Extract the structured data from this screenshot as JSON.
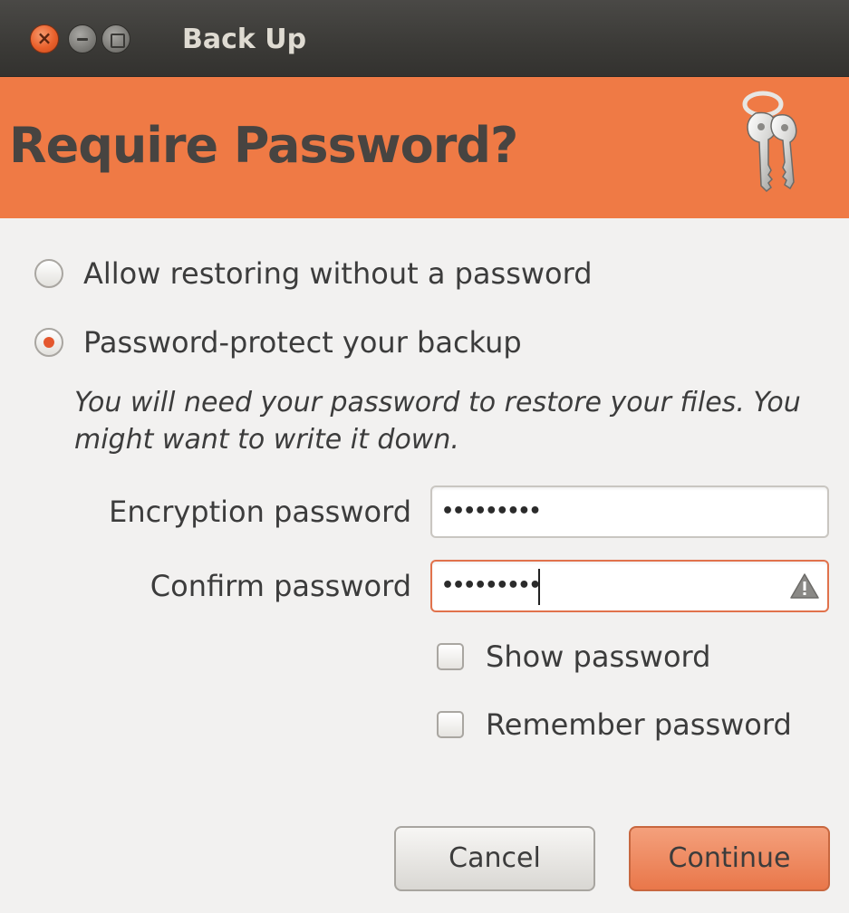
{
  "window": {
    "title": "Back Up",
    "controls": [
      "close-icon",
      "minimize-icon",
      "maximize-icon"
    ]
  },
  "header": {
    "title": "Require Password?",
    "icon": "keys-icon",
    "background": "#ef7a45"
  },
  "options": {
    "no_password_label": "Allow restoring without a password",
    "no_password_selected": false,
    "protect_label": "Password-protect your backup",
    "protect_selected": true,
    "hint": "You will need your password to restore your files. You might want to write it down."
  },
  "form": {
    "encryption_label": "Encryption password",
    "encryption_value": "•••••••••",
    "confirm_label": "Confirm password",
    "confirm_value": "•••••••••",
    "confirm_status_icon": "warning-icon",
    "show_password_label": "Show password",
    "show_password_checked": false,
    "remember_password_label": "Remember password",
    "remember_password_checked": false
  },
  "buttons": {
    "cancel_label": "Cancel",
    "continue_label": "Continue",
    "accent": "#e9774a"
  }
}
